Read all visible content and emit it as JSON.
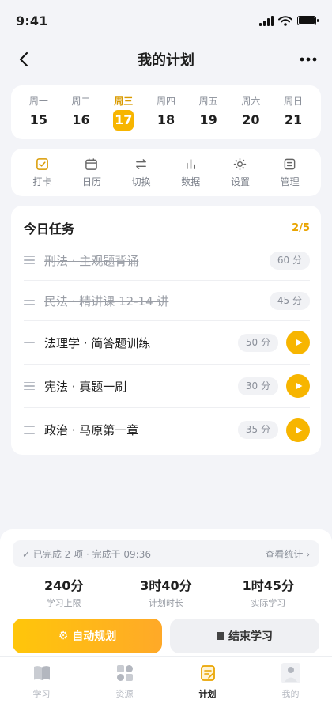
{
  "status_bar": {
    "time": "9:41"
  },
  "nav": {
    "title": "我的计划"
  },
  "week": [
    {
      "name": "周一",
      "num": "15"
    },
    {
      "name": "周二",
      "num": "16"
    },
    {
      "name": "周三",
      "num": "17",
      "active": true
    },
    {
      "name": "周四",
      "num": "18"
    },
    {
      "name": "周五",
      "num": "19"
    },
    {
      "name": "周六",
      "num": "20"
    },
    {
      "name": "周日",
      "num": "21"
    }
  ],
  "tools": [
    {
      "label": "打卡",
      "icon": "checkin-icon"
    },
    {
      "label": "日历",
      "icon": "calendar-icon"
    },
    {
      "label": "切换",
      "icon": "swap-icon"
    },
    {
      "label": "数据",
      "icon": "bar-chart-icon"
    },
    {
      "label": "设置",
      "icon": "settings-sun-icon"
    },
    {
      "label": "管理",
      "icon": "manage-icon"
    }
  ],
  "tasks": {
    "title": "今日任务",
    "count": "2/5",
    "items": [
      {
        "name": "刑法 · 主观题背诵",
        "duration": "60 分",
        "done": true
      },
      {
        "name": "民法 · 精讲课 12-14 讲",
        "duration": "45 分",
        "done": true
      },
      {
        "name": "法理学 · 简答题训练",
        "duration": "50 分",
        "done": false
      },
      {
        "name": "宪法 · 真题一刷",
        "duration": "30 分",
        "done": false
      },
      {
        "name": "政治 · 马原第一章",
        "duration": "35 分",
        "done": false
      }
    ]
  },
  "summary": {
    "text": "✓ 已完成 2 项 · 完成于 09:36",
    "link": "查看统计 ›"
  },
  "stats": [
    {
      "value": "240分",
      "label": "学习上限"
    },
    {
      "value": "3时40分",
      "label": "计划时长"
    },
    {
      "value": "1时45分",
      "label": "实际学习"
    }
  ],
  "actions": {
    "primary": "自动规划",
    "primary_icon": "⚙",
    "secondary": "结束学习"
  },
  "tabbar": [
    {
      "label": "学习",
      "icon": "book-icon"
    },
    {
      "label": "资源",
      "icon": "grid-icon"
    },
    {
      "label": "计划",
      "icon": "plan-icon",
      "active": true
    },
    {
      "label": "我的",
      "icon": "profile-icon"
    }
  ],
  "colors": {
    "accent": "#f7b500",
    "accent_text": "#e9a400",
    "background": "#f3f4f8"
  }
}
